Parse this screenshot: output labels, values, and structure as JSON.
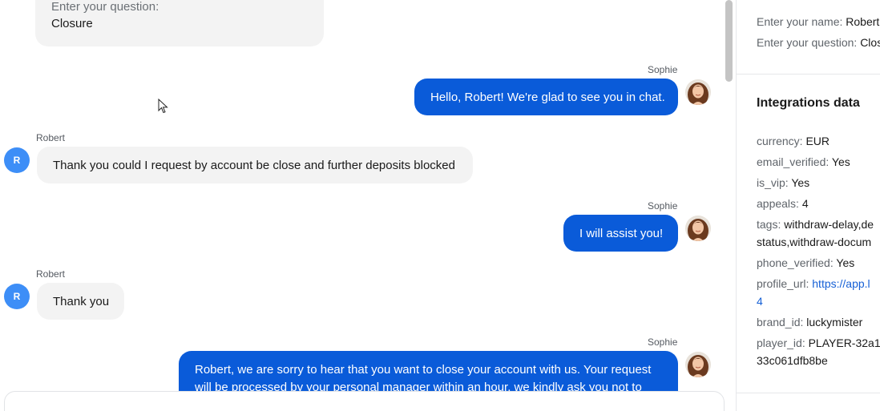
{
  "chat": {
    "form_card": {
      "question_label": "Enter your question:",
      "question_value": "Closure"
    },
    "messages": [
      {
        "sender": "Sophie",
        "text": "Hello, Robert! We're glad to see you in chat."
      },
      {
        "sender": "Robert",
        "avatar_letter": "R",
        "text": "Thank you could I request by account be close and further deposits blocked"
      },
      {
        "sender": "Sophie",
        "text": "I will assist you!"
      },
      {
        "sender": "Robert",
        "avatar_letter": "R",
        "text": "Thank you"
      },
      {
        "sender": "Sophie",
        "text_line1": "Robert, we are sorry to hear that you want to close your account with us. Your request",
        "text_line2": "will be processed by your personal manager within an hour, we kindly ask you not to"
      }
    ]
  },
  "panel": {
    "form_fields": [
      {
        "key": "Enter your name:",
        "value": "Robert"
      },
      {
        "key": "Enter your question:",
        "value": "Closure"
      }
    ],
    "integrations_title": "Integrations data",
    "integrations": {
      "currency": {
        "key": "currency:",
        "value": "EUR"
      },
      "email_verified": {
        "key": "email_verified:",
        "value": "Yes"
      },
      "is_vip": {
        "key": "is_vip:",
        "value": "Yes"
      },
      "appeals": {
        "key": "appeals:",
        "value": "4"
      },
      "tags": {
        "key": "tags:",
        "value_line1": "withdraw-delay,de",
        "value_line2": "status,withdraw-docum"
      },
      "phone_verified": {
        "key": "phone_verified:",
        "value": "Yes"
      },
      "profile_url": {
        "key": "profile_url:",
        "value_line1": "https://app.l",
        "value_line2": "4"
      },
      "brand_id": {
        "key": "brand_id:",
        "value": "luckymister"
      },
      "player_id": {
        "key": "player_id:",
        "value_line1": "PLAYER-32a1",
        "value_line2": "33c061dfb8be"
      }
    }
  },
  "colors": {
    "outgoing_bubble": "#0a5bd9",
    "incoming_bubble": "#f3f3f3",
    "robert_avatar": "#3d8ef7",
    "link": "#1660d6"
  }
}
